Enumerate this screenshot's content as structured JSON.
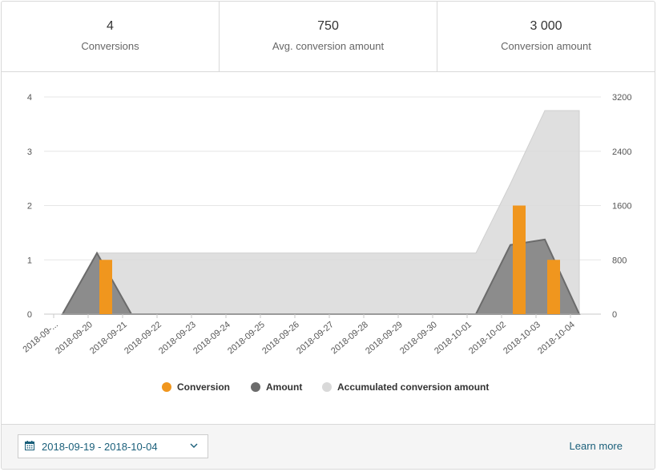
{
  "stats": [
    {
      "value": "4",
      "label": "Conversions"
    },
    {
      "value": "750",
      "label": "Avg. conversion amount"
    },
    {
      "value": "3 000",
      "label": "Conversion amount"
    }
  ],
  "footer": {
    "date_range": "2018-09-19 - 2018-10-04",
    "learn_more": "Learn more",
    "calendar_icon": "calendar-icon",
    "dropdown_icon": "chevron-down-icon"
  },
  "chart_data": {
    "type": "bar",
    "categories": [
      "2018-09-...",
      "2018-09-20",
      "2018-09-21",
      "2018-09-22",
      "2018-09-23",
      "2018-09-24",
      "2018-09-25",
      "2018-09-26",
      "2018-09-27",
      "2018-09-28",
      "2018-09-29",
      "2018-09-30",
      "2018-10-01",
      "2018-10-02",
      "2018-10-03",
      "2018-10-04"
    ],
    "left_axis": {
      "ticks": [
        "0",
        "1",
        "2",
        "3",
        "4"
      ],
      "range": [
        0,
        4
      ]
    },
    "right_axis": {
      "ticks": [
        "0",
        "800",
        "1600",
        "2400",
        "3200"
      ],
      "range": [
        0,
        3200
      ]
    },
    "series": [
      {
        "name": "Conversion",
        "type": "bar",
        "axis": "left",
        "color": "#f0961e",
        "values": [
          0,
          1,
          0,
          0,
          0,
          0,
          0,
          0,
          0,
          0,
          0,
          0,
          0,
          2,
          1,
          0
        ]
      },
      {
        "name": "Amount",
        "type": "area",
        "axis": "right",
        "color": "#6b6b6b",
        "values": [
          0,
          900,
          0,
          0,
          0,
          0,
          0,
          0,
          0,
          0,
          0,
          0,
          0,
          1020,
          1100,
          0
        ]
      },
      {
        "name": "Accumulated conversion amount",
        "type": "area",
        "axis": "right",
        "color": "#d9d9d9",
        "values": [
          0,
          900,
          900,
          900,
          900,
          900,
          900,
          900,
          900,
          900,
          900,
          900,
          900,
          1920,
          3000,
          3000
        ]
      }
    ],
    "legend": "bottom-center",
    "grid": true
  }
}
